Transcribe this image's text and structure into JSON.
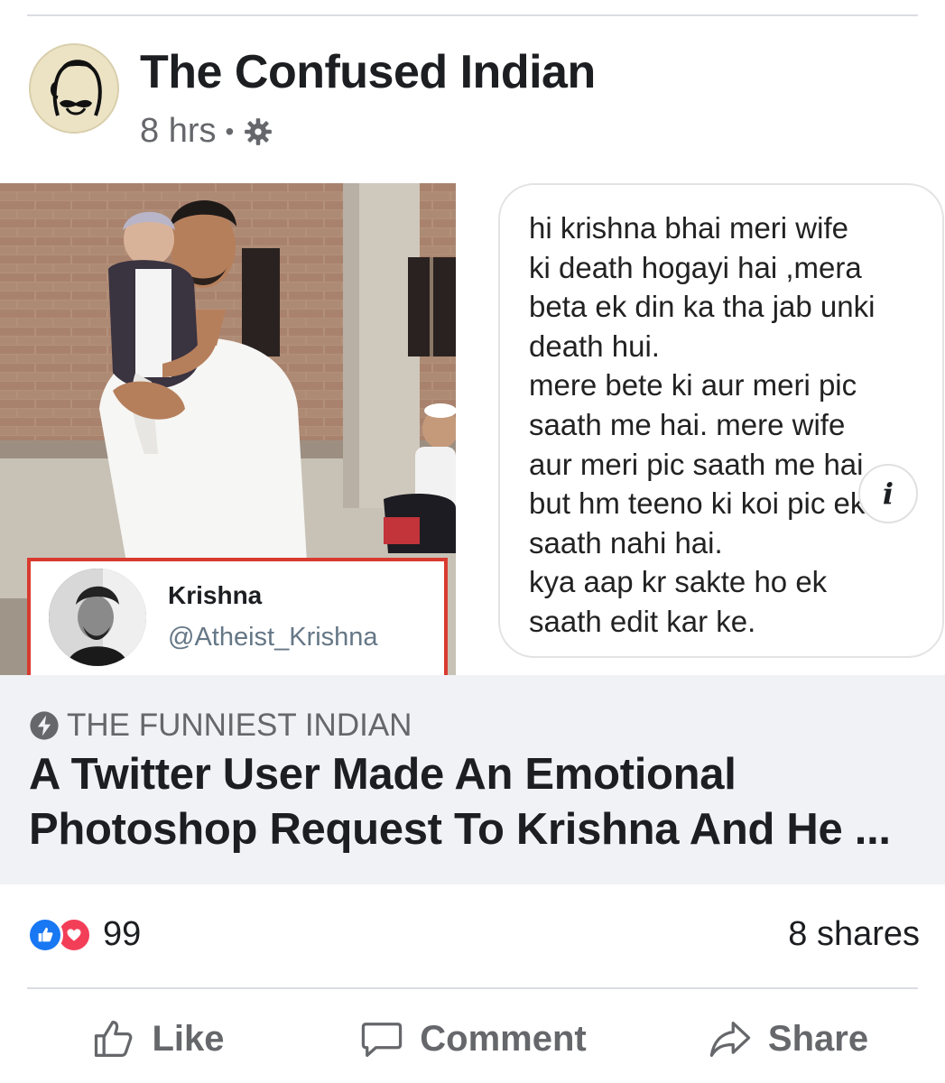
{
  "post": {
    "page_name": "The Confused Indian",
    "time": "8 hrs",
    "separator": "•",
    "privacy_icon": "gear-icon"
  },
  "media": {
    "twitter_card": {
      "name": "Krishna",
      "handle": "@Atheist_Krishna"
    },
    "chat_message": "hi krishna bhai meri wife\nki death hogayi hai ,mera\nbeta ek din ka tha jab unki\ndeath hui.\nmere bete ki aur meri pic\nsaath me hai. mere wife\naur meri pic saath me hai\nbut hm teeno ki koi pic ek\nsaath nahi hai.\nkya aap kr sakte ho ek\nsaath  edit kar ke.",
    "info_label": "i"
  },
  "link": {
    "source": "THE FUNNIEST INDIAN",
    "headline": "A Twitter User Made An Emotional Photoshop Request To Krishna And He ..."
  },
  "stats": {
    "reaction_count": "99",
    "shares": "8 shares",
    "reaction_colors": {
      "like": "#1877f2",
      "love": "#f33e58"
    }
  },
  "actions": {
    "like": "Like",
    "comment": "Comment",
    "share": "Share"
  }
}
